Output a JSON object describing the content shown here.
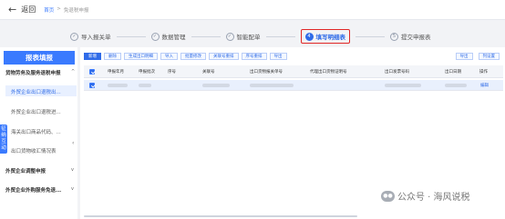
{
  "topbar": {
    "back_label": "返回",
    "crumb_home": "首页",
    "crumb_sep": ">",
    "crumb_current": "免退税申报"
  },
  "steps": [
    {
      "num": "✓",
      "label": "导入报关单"
    },
    {
      "num": "✓",
      "label": "数据管理"
    },
    {
      "num": "✓",
      "label": "智能配单"
    },
    {
      "num": "4",
      "label": "填写明细表"
    },
    {
      "num": "5",
      "label": "提交申报表"
    }
  ],
  "sidebar": {
    "title": "报表填报",
    "groups": [
      {
        "label": "货物劳务及服务退税申报"
      },
      {
        "label": "外贸企业出口退税出..."
      },
      {
        "label": "外贸企业出口退税进..."
      },
      {
        "label": "海关出口商品代码、..."
      },
      {
        "label": "出口货物收汇情况表"
      },
      {
        "label": "外贸企业调整申报"
      },
      {
        "label": "外贸企业外购服务免退..."
      }
    ],
    "mutual_tab": [
      "征",
      "纳",
      "互",
      "动"
    ]
  },
  "toolbar": {
    "buttons": [
      "新增",
      "删除",
      "生成出口明细",
      "导入",
      "批量修改",
      "关联号重排",
      "序号重排",
      "导出"
    ],
    "right": [
      "导出",
      "列设置"
    ]
  },
  "table": {
    "headers": [
      "申报年月",
      "申报批次",
      "序号",
      "关联号",
      "出口货物报关单号",
      "代理出口货物证明号",
      "出口发票号码",
      "出口日期",
      "操作"
    ],
    "row_action": "编辑"
  },
  "watermark": {
    "text": "公众号 · 海风说税"
  }
}
